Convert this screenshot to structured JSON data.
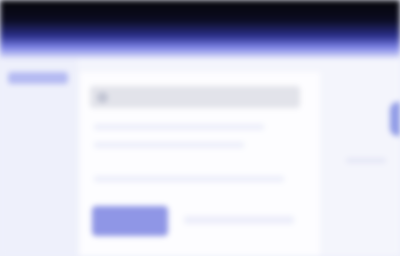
{
  "search": {
    "value": "",
    "placeholder": ""
  },
  "colors": {
    "header_gradient_dark": "#050508",
    "accent": "#8f96e6",
    "sidebar_active": "#b4baf2",
    "panel_background": "#fdfdff",
    "page_background": "#f4f5fc"
  },
  "icons": {
    "search": "search-icon"
  }
}
